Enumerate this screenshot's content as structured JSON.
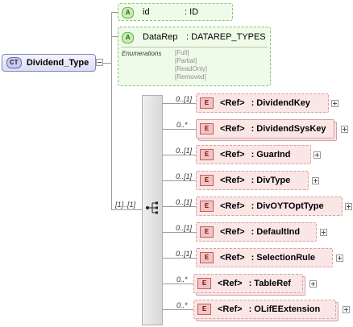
{
  "complex_type": {
    "badge": "CT",
    "name": "Dividend_Type"
  },
  "attributes": [
    {
      "badge": "A",
      "name": "id",
      "type": ": ID"
    },
    {
      "badge": "A",
      "name": "DataRep",
      "type": ": DATAREP_TYPES",
      "enumerations_label": "Enumerations",
      "enumerations": [
        "[Full]",
        "[Partial]",
        "[ReadOnly]",
        "[Removed]"
      ]
    }
  ],
  "sequence": {
    "occurrence": "[1]..[1]"
  },
  "elements": [
    {
      "occurrence": "0..[1]",
      "badge": "E",
      "ref": "<Ref>",
      "name": ": DividendKey",
      "multiple": false
    },
    {
      "occurrence": "0..*",
      "badge": "E",
      "ref": "<Ref>",
      "name": ": DividendSysKey",
      "multiple": true
    },
    {
      "occurrence": "0..[1]",
      "badge": "E",
      "ref": "<Ref>",
      "name": ": GuarInd",
      "multiple": false
    },
    {
      "occurrence": "0..[1]",
      "badge": "E",
      "ref": "<Ref>",
      "name": ": DivType",
      "multiple": false
    },
    {
      "occurrence": "0..[1]",
      "badge": "E",
      "ref": "<Ref>",
      "name": ": DivOYTOptType",
      "multiple": false
    },
    {
      "occurrence": "0..[1]",
      "badge": "E",
      "ref": "<Ref>",
      "name": ": DefaultInd",
      "multiple": false
    },
    {
      "occurrence": "0..[1]",
      "badge": "E",
      "ref": "<Ref>",
      "name": ": SelectionRule",
      "multiple": false
    },
    {
      "occurrence": "0..*",
      "badge": "E",
      "ref": "<Ref>",
      "name": ": TableRef",
      "multiple": true
    },
    {
      "occurrence": "0..*",
      "badge": "E",
      "ref": "<Ref>",
      "name": ": OLifEExtension",
      "multiple": true
    }
  ]
}
